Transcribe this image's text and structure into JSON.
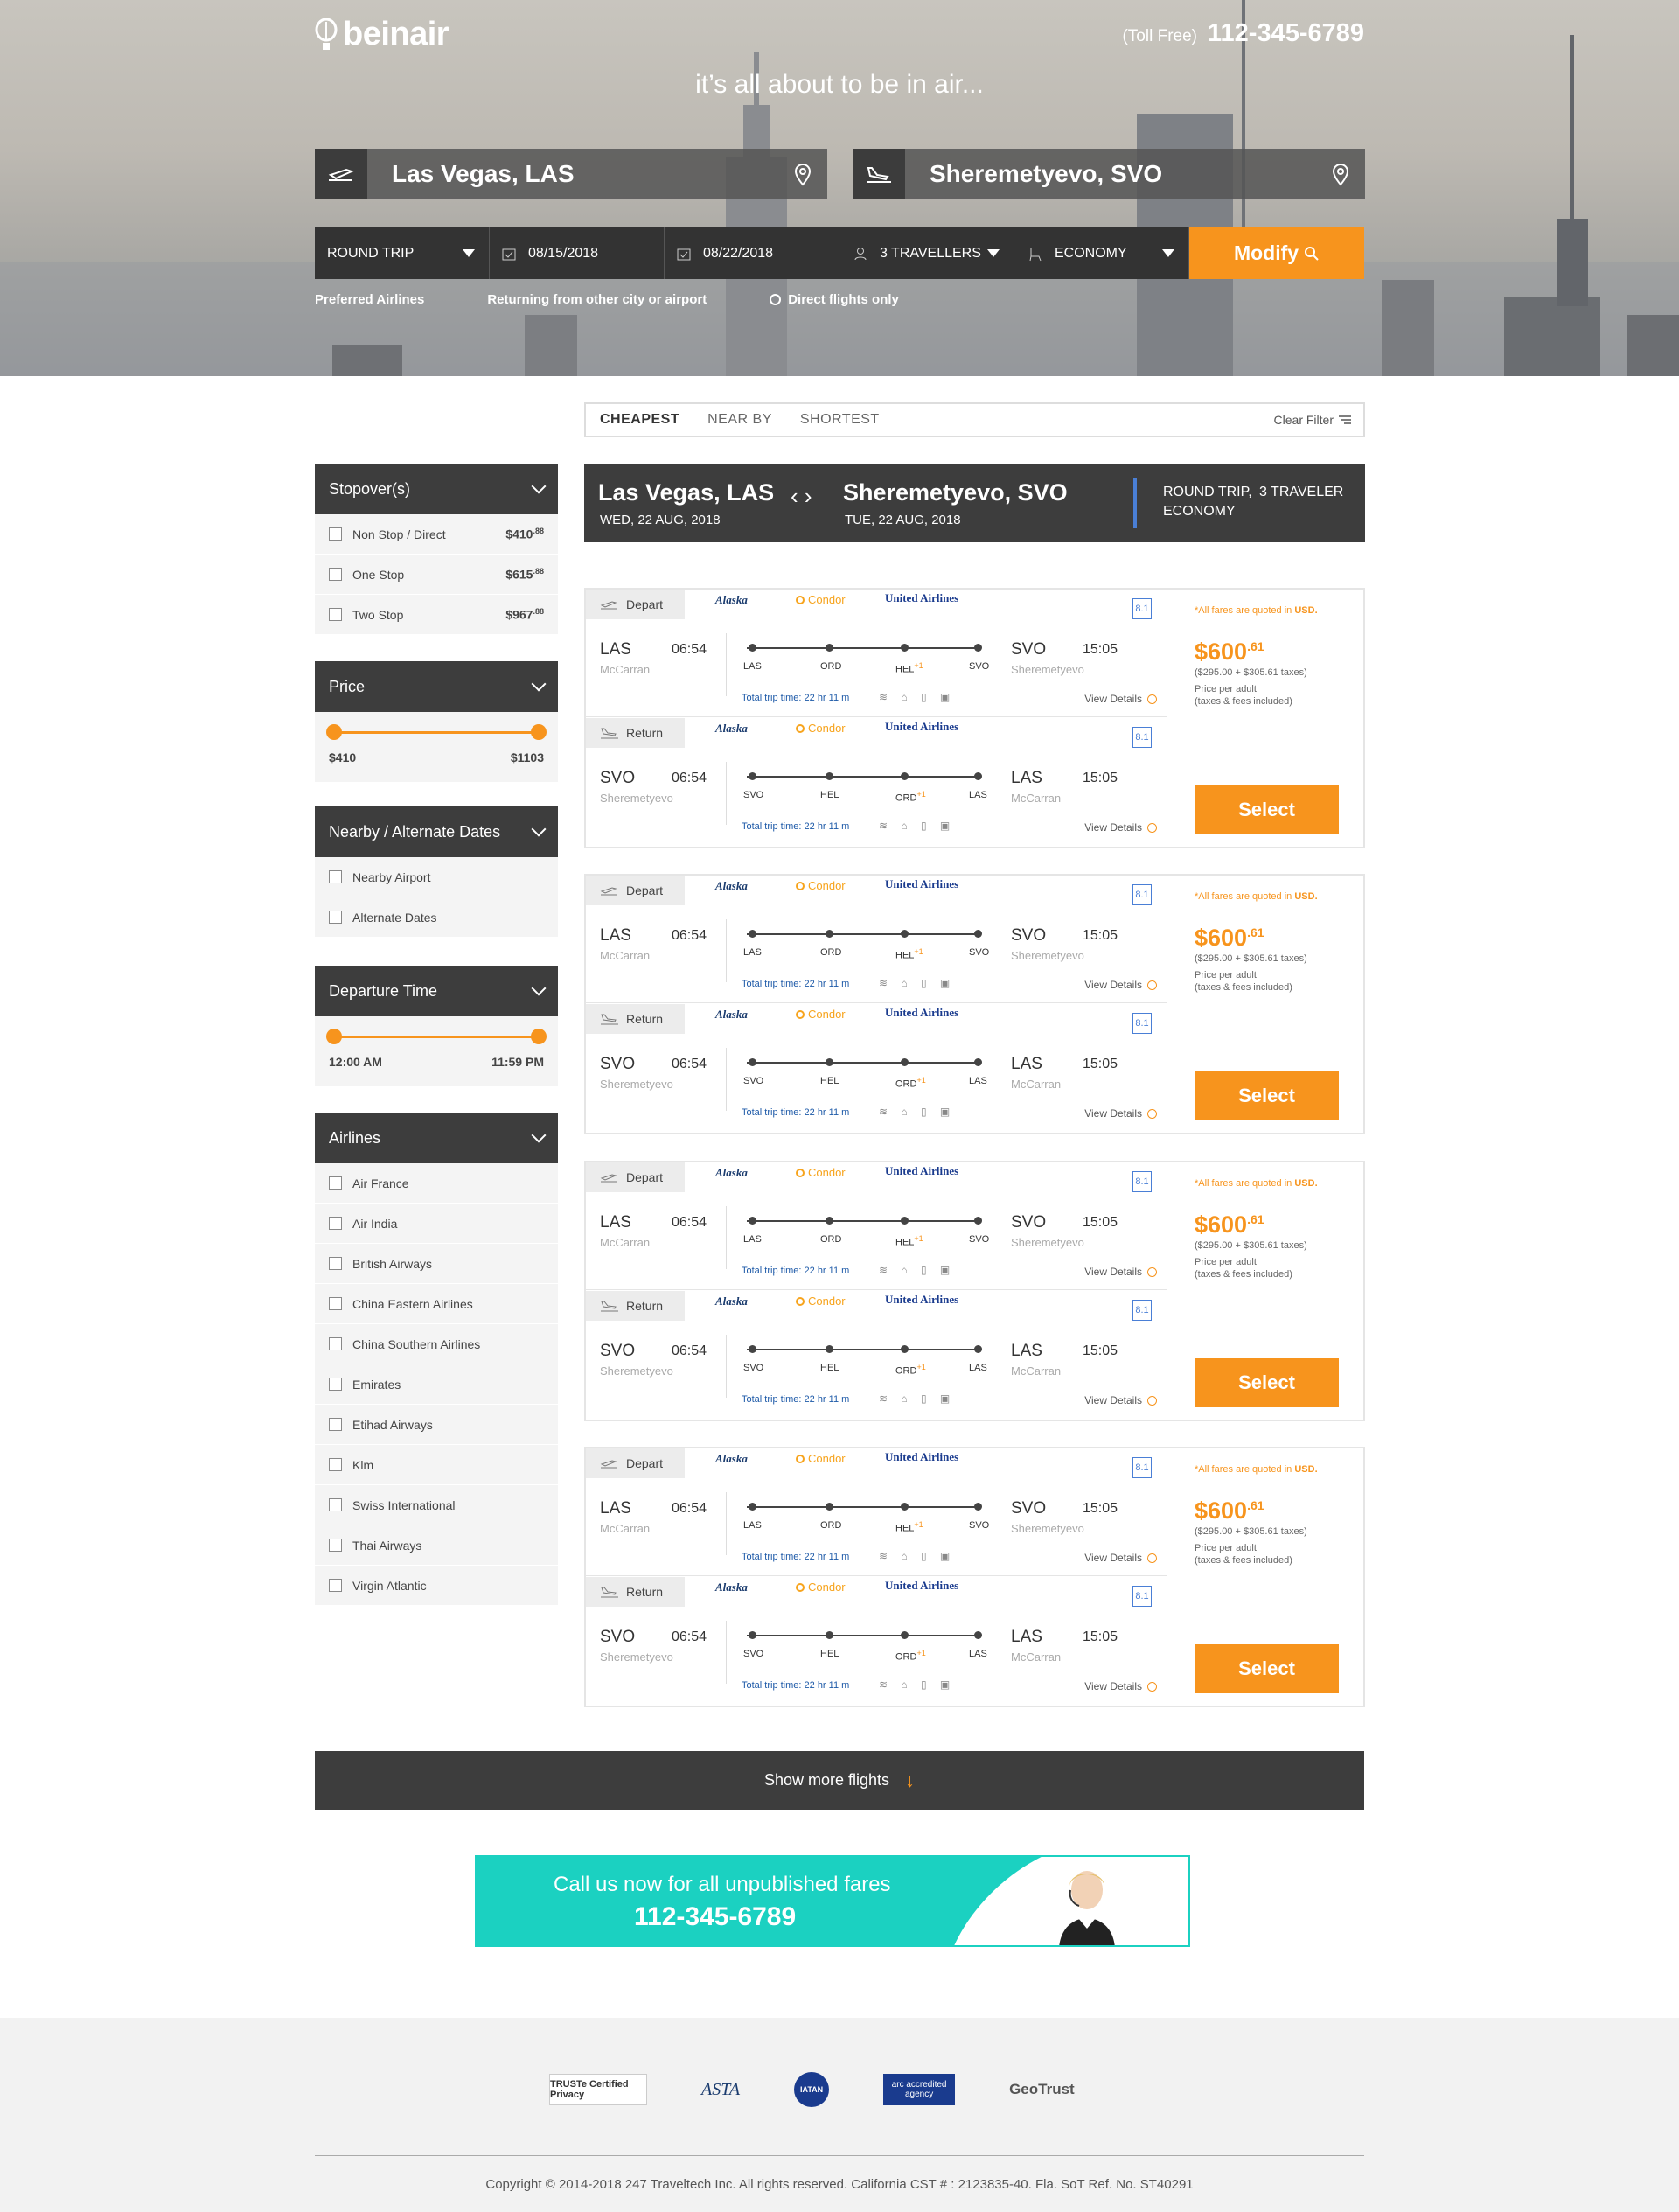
{
  "brand": {
    "name": "beinair",
    "toll_label": "(Toll Free)",
    "phone": "112-345-6789",
    "tagline": "it’s all about to be  in air..."
  },
  "search": {
    "from": "Las Vegas, LAS",
    "to": "Sheremetyevo, SVO",
    "trip_type": "ROUND TRIP",
    "depart_date": "08/15/2018",
    "return_date": "08/22/2018",
    "travellers": "3 TRAVELLERS",
    "cabin": "ECONOMY",
    "modify_label": "Modify",
    "options": [
      "Preferred Airlines",
      "Returning from other city or airport",
      "Direct flights only"
    ]
  },
  "sort": {
    "tabs": [
      "CHEAPEST",
      "NEAR BY",
      "SHORTEST"
    ],
    "active": "CHEAPEST",
    "clear_label": "Clear Filter"
  },
  "filters": {
    "stopovers": {
      "title": "Stopover(s)",
      "items": [
        {
          "label": "Non Stop / Direct",
          "price": "$410",
          "cents": ".88"
        },
        {
          "label": "One Stop",
          "price": "$615",
          "cents": ".88"
        },
        {
          "label": "Two Stop",
          "price": "$967",
          "cents": ".88"
        }
      ]
    },
    "price": {
      "title": "Price",
      "min": "$410",
      "max": "$1103",
      "range": [
        0,
        1
      ]
    },
    "nearby": {
      "title": "Nearby / Alternate Dates",
      "items": [
        "Nearby Airport",
        "Alternate Dates"
      ]
    },
    "departure": {
      "title": "Departure Time",
      "min": "12:00 AM",
      "max": "11:59 PM",
      "range": [
        0,
        1
      ]
    },
    "airlines": {
      "title": "Airlines",
      "items": [
        "Air France",
        "Air India",
        "British Airways",
        "China Eastern Airlines",
        "China Southern Airlines",
        "Emirates",
        "Etihad Airways",
        "Klm",
        "Swiss International",
        "Thai Airways",
        "Virgin Atlantic"
      ]
    }
  },
  "route": {
    "from": "Las Vegas, LAS",
    "from_date": "WED, 22 AUG, 2018",
    "to": "Sheremetyevo, SVO",
    "to_date": "TUE, 22 AUG, 2018",
    "trip": "ROUND TRIP,",
    "travelers": "3 TRAVELER",
    "cabin": "ECONOMY"
  },
  "airline_logos": {
    "alaska": "Alaska",
    "condor": "Condor",
    "united": "United Airlines"
  },
  "result_labels": {
    "depart": "Depart",
    "return": "Return",
    "note_prefix": "*All fares are quoted in",
    "note_cur": "USD.",
    "view": "View Details",
    "select": "Select",
    "ppa1": "Price per adult",
    "ppa2": "(taxes & fees included)",
    "badge": "8.1"
  },
  "results": [
    {
      "price": "$600",
      "cents": ".61",
      "breakdown": "($295.00 + $305.61 taxes)",
      "depart": {
        "from_code": "LAS",
        "from_name": "McCarran",
        "dep_time": "06:54",
        "to_code": "SVO",
        "to_name": "Sheremetyevo",
        "arr_time": "15:05",
        "stops": [
          "LAS",
          "ORD",
          "HEL",
          "SVO"
        ],
        "trip_time": "Total trip time: 22 hr 11 m"
      },
      "return": {
        "from_code": "SVO",
        "from_name": "Sheremetyevo",
        "dep_time": "06:54",
        "to_code": "LAS",
        "to_name": "McCarran",
        "arr_time": "15:05",
        "stops": [
          "SVO",
          "HEL",
          "ORD",
          "LAS"
        ],
        "trip_time": "Total trip time: 22 hr 11 m"
      }
    },
    {
      "price": "$600",
      "cents": ".61",
      "breakdown": "($295.00 + $305.61 taxes)",
      "depart": {
        "from_code": "LAS",
        "from_name": "McCarran",
        "dep_time": "06:54",
        "to_code": "SVO",
        "to_name": "Sheremetyevo",
        "arr_time": "15:05",
        "stops": [
          "LAS",
          "ORD",
          "HEL",
          "SVO"
        ],
        "trip_time": "Total trip time: 22 hr 11 m"
      },
      "return": {
        "from_code": "SVO",
        "from_name": "Sheremetyevo",
        "dep_time": "06:54",
        "to_code": "LAS",
        "to_name": "McCarran",
        "arr_time": "15:05",
        "stops": [
          "SVO",
          "HEL",
          "ORD",
          "LAS"
        ],
        "trip_time": "Total trip time: 22 hr 11 m"
      }
    },
    {
      "price": "$600",
      "cents": ".61",
      "breakdown": "($295.00 + $305.61 taxes)",
      "depart": {
        "from_code": "LAS",
        "from_name": "McCarran",
        "dep_time": "06:54",
        "to_code": "SVO",
        "to_name": "Sheremetyevo",
        "arr_time": "15:05",
        "stops": [
          "LAS",
          "ORD",
          "HEL",
          "SVO"
        ],
        "trip_time": "Total trip time: 22 hr 11 m"
      },
      "return": {
        "from_code": "SVO",
        "from_name": "Sheremetyevo",
        "dep_time": "06:54",
        "to_code": "LAS",
        "to_name": "McCarran",
        "arr_time": "15:05",
        "stops": [
          "SVO",
          "HEL",
          "ORD",
          "LAS"
        ],
        "trip_time": "Total trip time: 22 hr 11 m"
      }
    },
    {
      "price": "$600",
      "cents": ".61",
      "breakdown": "($295.00 + $305.61 taxes)",
      "depart": {
        "from_code": "LAS",
        "from_name": "McCarran",
        "dep_time": "06:54",
        "to_code": "SVO",
        "to_name": "Sheremetyevo",
        "arr_time": "15:05",
        "stops": [
          "LAS",
          "ORD",
          "HEL",
          "SVO"
        ],
        "trip_time": "Total trip time: 22 hr 11 m"
      },
      "return": {
        "from_code": "SVO",
        "from_name": "Sheremetyevo",
        "dep_time": "06:54",
        "to_code": "LAS",
        "to_name": "McCarran",
        "arr_time": "15:05",
        "stops": [
          "SVO",
          "HEL",
          "ORD",
          "LAS"
        ],
        "trip_time": "Total trip time: 22 hr 11 m"
      }
    }
  ],
  "show_more": "Show more flights",
  "call_banner": {
    "line1": "Call us now for all unpublished fares",
    "phone": "112-345-6789"
  },
  "footer": {
    "badges": [
      "TRUSTe Certified Privacy",
      "ASTA",
      "IATAN",
      "arc accredited agency",
      "GeoTrust"
    ],
    "copyright": "Copyright © 2014-2018 247 Traveltech Inc. All rights reserved. California CST # : 2123835-40. Fla. SoT Ref. No. ST40291"
  },
  "colors": {
    "accent": "#f7941d",
    "dark": "#3d3d3d",
    "teal": "#1bd1c1",
    "link": "#1e5aa8"
  }
}
